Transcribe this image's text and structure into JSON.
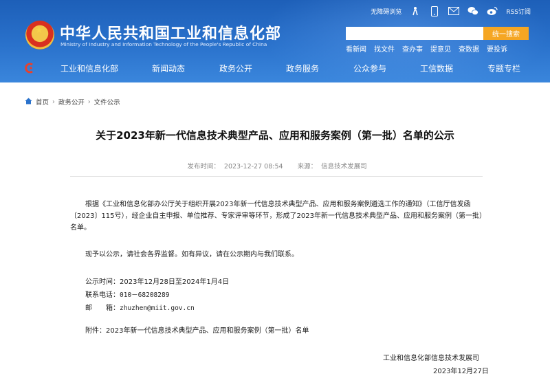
{
  "header": {
    "site_title": "中华人民共和国工业和信息化部",
    "site_subtitle": "Ministry of Industry and Information Technology of the People's Republic of China",
    "top_links": {
      "accessibility": "无障碍浏览",
      "rss": "RSS订阅"
    },
    "search": {
      "placeholder": "",
      "button_label": "统一搜索"
    },
    "quick_links": [
      "看新闻",
      "找文件",
      "查办事",
      "提意见",
      "查数据",
      "要投诉"
    ]
  },
  "nav": {
    "items": [
      "工业和信息化部",
      "新闻动态",
      "政务公开",
      "政务服务",
      "公众参与",
      "工信数据",
      "专题专栏"
    ]
  },
  "breadcrumb": {
    "items": [
      "首页",
      "政务公开",
      "文件公示"
    ],
    "separator": "›"
  },
  "article": {
    "title": "关于2023年新一代信息技术典型产品、应用和服务案例（第一批）名单的公示",
    "publish_time_label": "发布时间：",
    "publish_time": "2023-12-27 08:54",
    "source_label": "来源：",
    "source": "信息技术发展司",
    "p1": "根据《工业和信息化部办公厅关于组织开展2023年新一代信息技术典型产品、应用和服务案例遴选工作的通知》（工信厅信发函〔2023〕115号），经企业自主申报、单位推荐、专家评审等环节，形成了2023年新一代信息技术典型产品、应用和服务案例（第一批）名单。",
    "p2": "现予以公示，请社会各界监督。如有异议，请在公示期内与我们联系。",
    "period_label": "公示时间：",
    "period": "2023年12月28日至2024年1月4日",
    "phone_label": "联系电话：",
    "phone": "010－68208289",
    "email_label": "邮　　箱：",
    "email": "zhuzhen@miit.gov.cn",
    "attachment_label": "附件：",
    "attachment": "2023年新一代信息技术典型产品、应用和服务案例（第一批）名单",
    "signature_org": "工业和信息化部信息技术发展司",
    "signature_date": "2023年12月27日"
  },
  "colors": {
    "header_blue": "#2a72cc",
    "search_button": "#f5a623"
  }
}
